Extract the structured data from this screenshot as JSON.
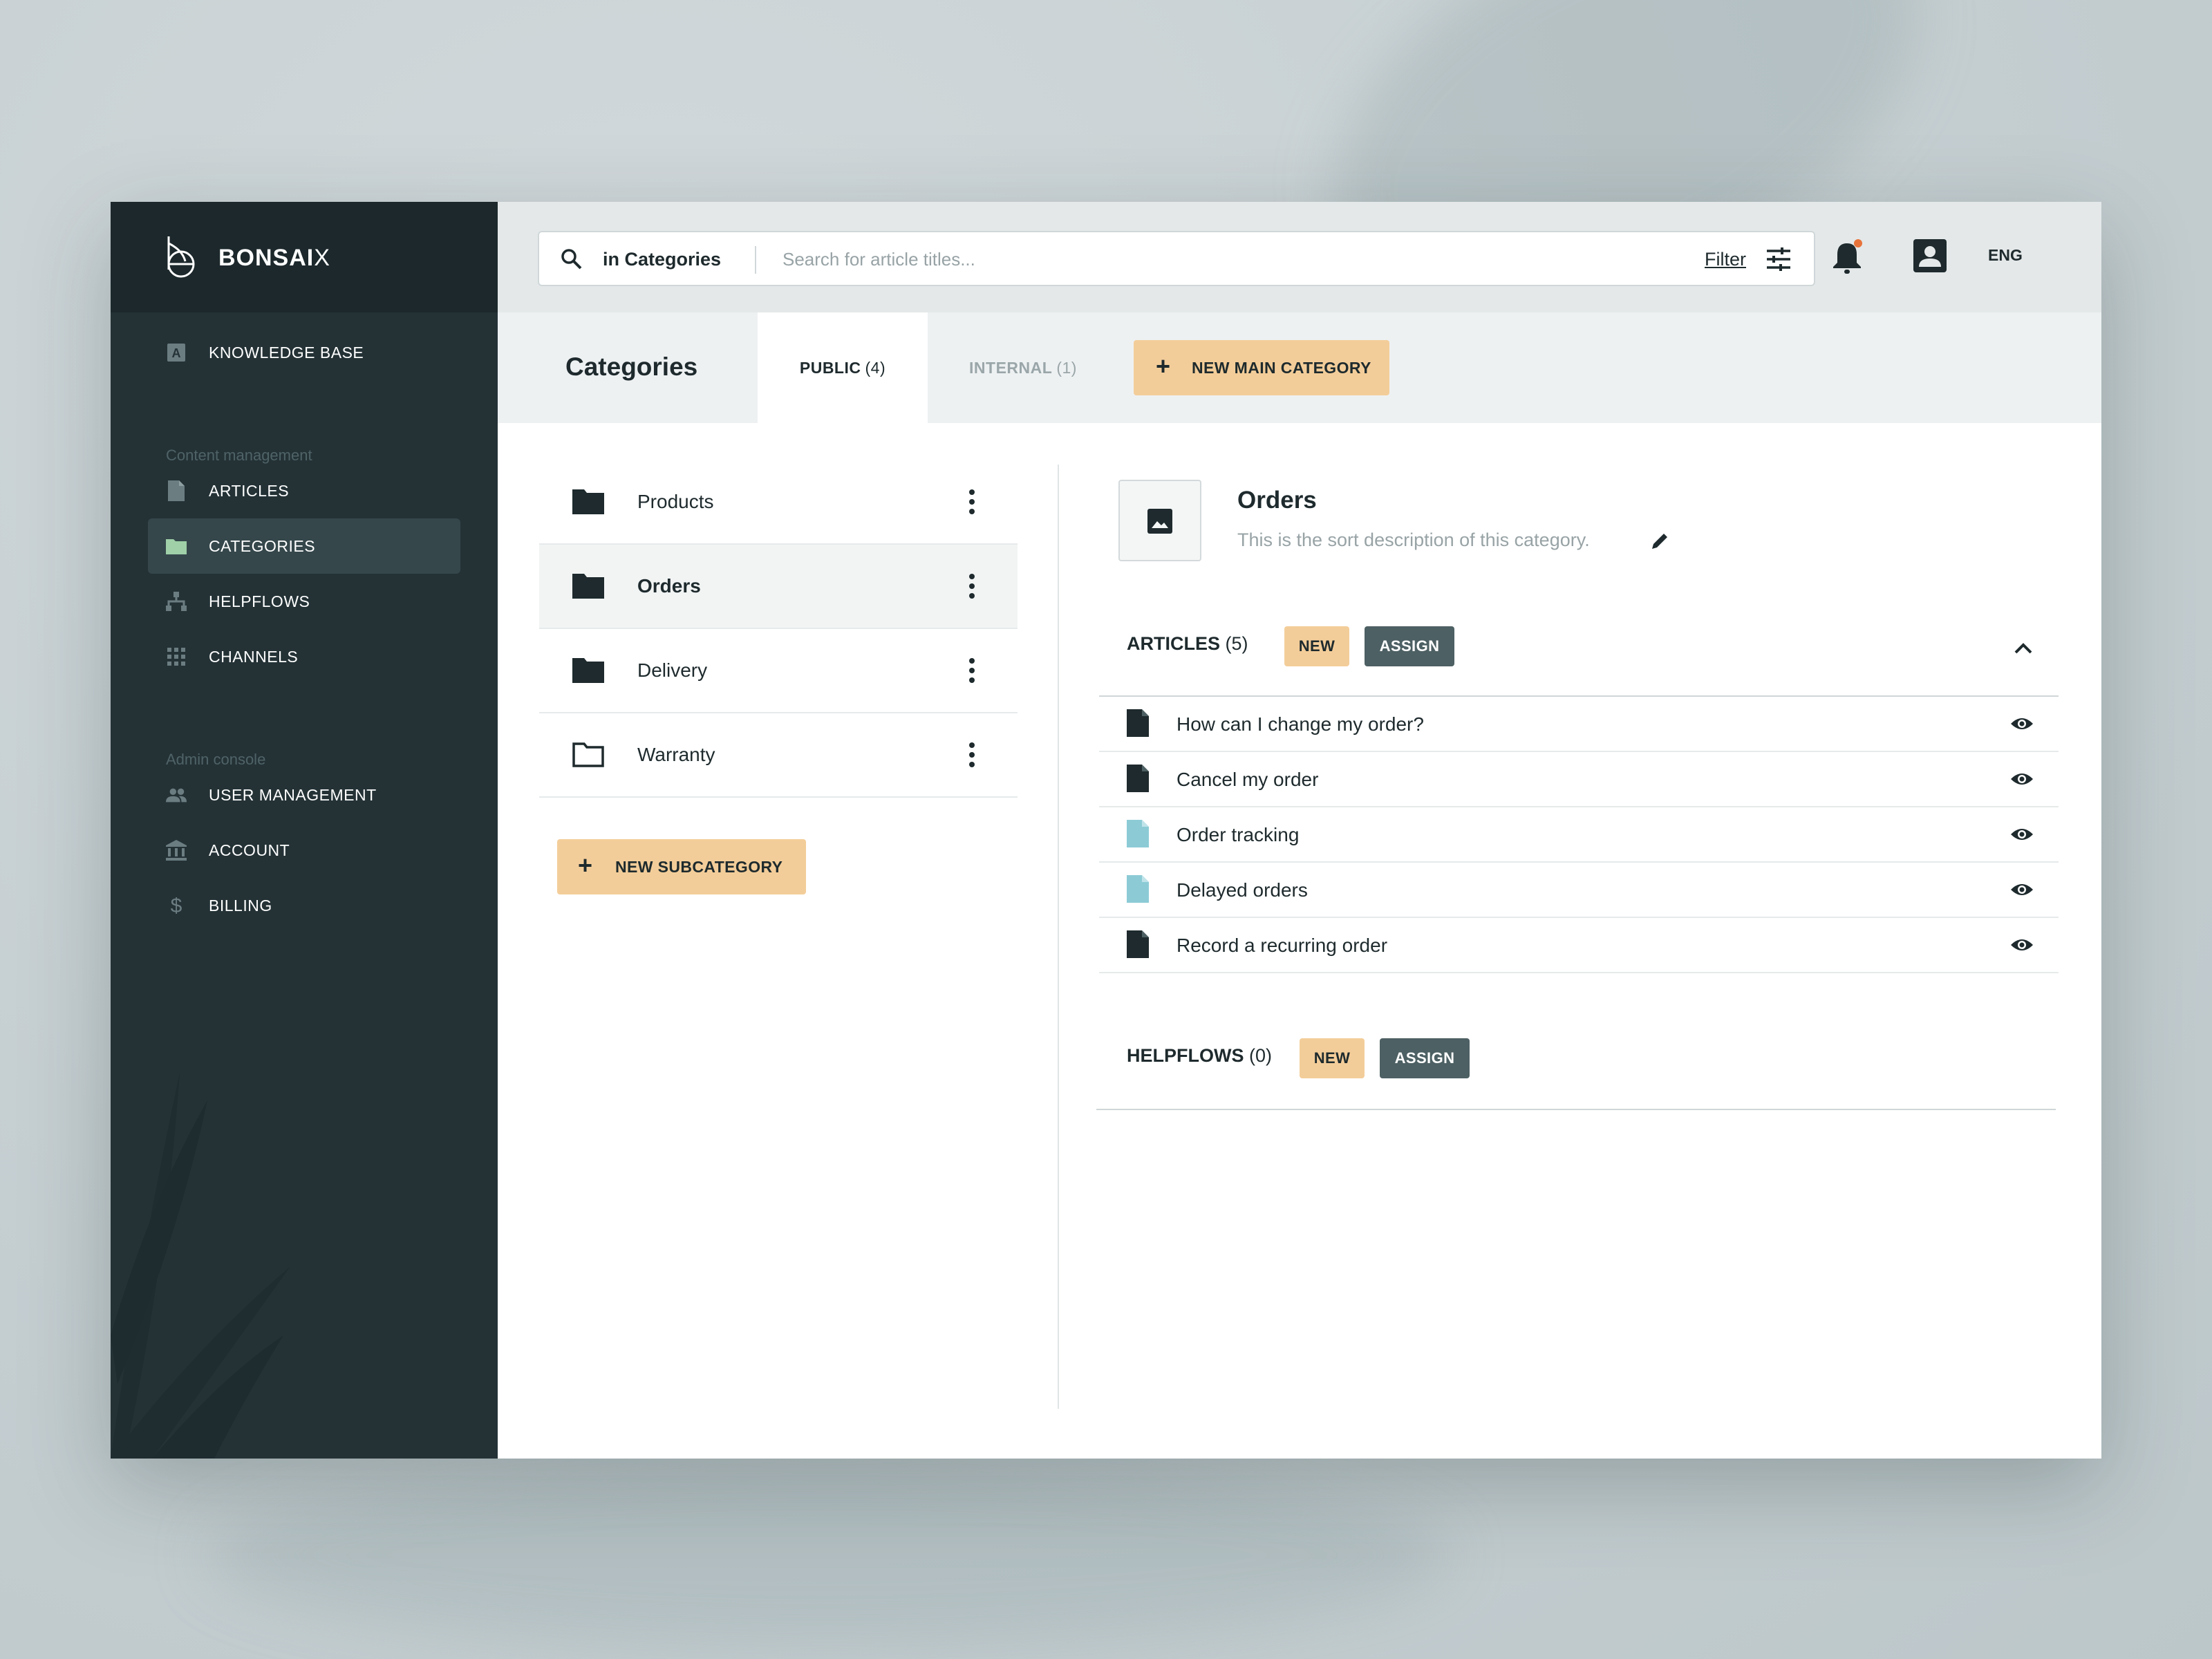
{
  "brand": {
    "name_main": "BONSAI",
    "name_x": "X"
  },
  "sidebar": {
    "top_item": {
      "label": "KNOWLEDGE BASE",
      "icon": "knowledge-base-icon"
    },
    "sections": [
      {
        "title": "Content management",
        "items": [
          {
            "label": "ARTICLES",
            "icon": "article-icon",
            "active": false
          },
          {
            "label": "CATEGORIES",
            "icon": "folder-icon",
            "active": true
          },
          {
            "label": "HELPFLOWS",
            "icon": "hierarchy-icon",
            "active": false
          },
          {
            "label": "CHANNELS",
            "icon": "grid-icon",
            "active": false
          }
        ]
      },
      {
        "title": "Admin console",
        "items": [
          {
            "label": "USER MANAGEMENT",
            "icon": "users-icon",
            "active": false
          },
          {
            "label": "ACCOUNT",
            "icon": "bank-icon",
            "active": false
          },
          {
            "label": "BILLING",
            "icon": "dollar-icon",
            "active": false
          }
        ]
      }
    ]
  },
  "search": {
    "scope": "in Categories",
    "placeholder": "Search for article titles...",
    "filter_label": "Filter"
  },
  "header": {
    "language": "ENG",
    "notification_dot_color": "#e8733a"
  },
  "categories_page": {
    "title": "Categories",
    "tabs": [
      {
        "label": "PUBLIC",
        "count": "(4)",
        "active": true
      },
      {
        "label": "INTERNAL",
        "count": "(1)",
        "active": false
      }
    ],
    "new_main_category": "NEW MAIN CATEGORY",
    "list": [
      {
        "name": "Products",
        "folder": "filled",
        "selected": false
      },
      {
        "name": "Orders",
        "folder": "filled",
        "selected": true
      },
      {
        "name": "Delivery",
        "folder": "filled",
        "selected": false
      },
      {
        "name": "Warranty",
        "folder": "outline",
        "selected": false
      }
    ],
    "new_subcategory": "NEW SUBCATEGORY"
  },
  "detail": {
    "title": "Orders",
    "description": "This is the sort description of this category.",
    "articles": {
      "label": "ARTICLES",
      "count": "(5)",
      "new_label": "NEW",
      "assign_label": "ASSIGN",
      "items": [
        {
          "title": "How can I change my order?",
          "doc_color": "#1e2a2d"
        },
        {
          "title": "Cancel my order",
          "doc_color": "#1e2a2d"
        },
        {
          "title": "Order tracking",
          "doc_color": "#8ccbd6"
        },
        {
          "title": "Delayed orders",
          "doc_color": "#8ccbd6"
        },
        {
          "title": "Record a recurring order",
          "doc_color": "#1e2a2d"
        }
      ]
    },
    "helpflows": {
      "label": "HELPFLOWS",
      "count": "(0)",
      "new_label": "NEW",
      "assign_label": "ASSIGN"
    }
  },
  "colors": {
    "sidebar_bg": "#243236",
    "accent_peach": "#f3cd99",
    "assign_slate": "#4d6063",
    "doc_light_blue": "#8ccbd6"
  }
}
